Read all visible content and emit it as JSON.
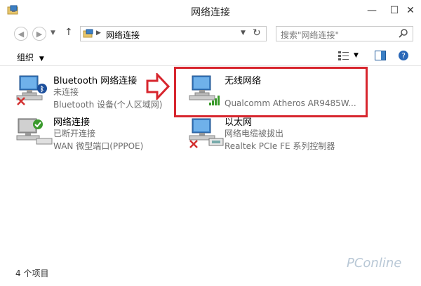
{
  "window": {
    "title": "网络连接",
    "controls": {
      "minimize": "—",
      "maximize": "☐",
      "close": "✕"
    }
  },
  "address": {
    "path": "网络连接",
    "search_placeholder": "搜索\"网络连接\""
  },
  "toolbar": {
    "organize_label": "组织"
  },
  "connections": [
    {
      "name": "Bluetooth 网络连接",
      "status": "未连接",
      "device": "Bluetooth 设备(个人区域网)"
    },
    {
      "name": "无线网络",
      "status": "",
      "device": "Qualcomm Atheros AR9485W..."
    },
    {
      "name": "网络连接",
      "status": "已断开连接",
      "device": "WAN 微型端口(PPPOE)"
    },
    {
      "name": "以太网",
      "status": "网络电缆被拔出",
      "device": "Realtek PCIe FE 系列控制器"
    }
  ],
  "statusbar": {
    "count": "4 个项目"
  },
  "watermark": "PConline",
  "colors": {
    "highlight": "#d7262e",
    "wifi_signal": "#3a9a2c",
    "error": "#d32f2f",
    "monitor": "#3b7fc4"
  }
}
